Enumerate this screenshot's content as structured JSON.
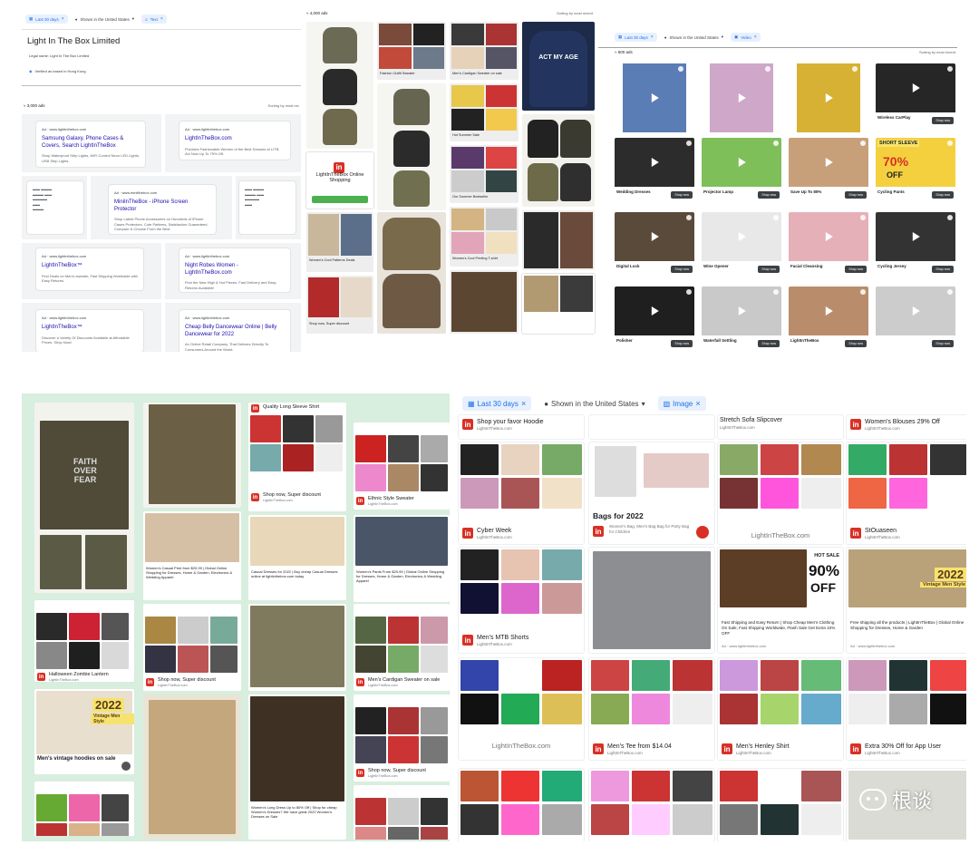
{
  "panel1": {
    "chips": [
      {
        "label": "Last 30 days",
        "icon": "calendar-icon"
      },
      {
        "label": "Shown in the United States",
        "icon": "location-icon"
      },
      {
        "label": "Text",
        "icon": "text-format-icon"
      }
    ],
    "advertiser_name": "Light In The Box Limited",
    "legal_name": "Legal name: Light In The Box Limited",
    "based_in": "Verified as based in Hong Kong",
    "ads_count": "≈ 3,000 ads",
    "sort_label": "Sorting by most rec",
    "cards": [
      {
        "ad": "Ad · www.lightinthebox.com",
        "title": "Samsung Galaxy, Phone Cases & Covers, Search LightInTheBox",
        "desc": "Shop Waterproof Strip Lights, WiFi Control Neon LED Lights, USB Strip Lights."
      },
      {
        "ad": "Ad · www.lightinthebox.com",
        "title": "LightInTheBox.com",
        "desc": "Provides Fashionable Women of the Best Dresses at LITB, Act Now Up To 75% Off."
      },
      {
        "ad": "Ad · www.minitthebox.com",
        "title": "MiniInTheBox - iPhone Screen Protector",
        "desc": "Shop Latest Phone Accessories on Hundreds of iPhone Cases Protectors, Cute Patterns, Satisfaction Guaranteed, Compare & Choose From the Best."
      },
      {
        "ad": "Ad · www.lightinthebox.com",
        "title": "LightInTheBox™",
        "desc": "Find Deals on Men's sweater, Fast Shipping Worldwide with Easy Returns."
      },
      {
        "ad": "Ad · www.lightinthebox.com",
        "title": "Night Robes Women - LightInTheBox.com",
        "desc": "Find the New High & Hot Pieces. Fast Delivery and Easy Returns Available!"
      },
      {
        "ad": "Ad · www.lightinthebox.com",
        "title": "LightInTheBox™",
        "desc": "Discover a Variety Of Discounts Available at Affordable Prices. Shop Now!"
      },
      {
        "ad": "Ad · www.lightinthebox.com",
        "title": "Cheap Belly Dancewear Online | Belly Dancewear for 2022",
        "desc": "An Online Retail Company, That Delivers Directly To Consumers Around the World."
      }
    ]
  },
  "panel2": {
    "ads_count": "≈ 4,000 ads",
    "sort_label": "Sorting by most recent",
    "labels": [
      "Fashion Outfit Sweater",
      "Men's Cardigan Sweater on sale",
      "LightInTheBox Online Shopping",
      "Hot Summer Sale",
      "Our Summer Bestseller",
      "Women's Cool Patterns Deals",
      "Women's Cool Printing T-shirt",
      "Shop now, Super discount"
    ],
    "shirt_print": "ACT MY AGE"
  },
  "panel3": {
    "chips": [
      {
        "label": "Last 30 days",
        "icon": "calendar-icon"
      },
      {
        "label": "Shown in the United States",
        "icon": "location-icon"
      },
      {
        "label": "Video",
        "icon": "video-icon"
      }
    ],
    "ads_count": "≈ 600 ads",
    "sort_label": "Sorting by most recent",
    "shop_now": "Shop now",
    "sale_text": "SHORT SLEEVE",
    "sale_pct": "70%",
    "sale_off": "OFF",
    "labels": [
      "Wireless CarPlay",
      "Wedding Dresses",
      "Projector Lamp",
      "Save Up To 80%",
      "Cycling Pants",
      "Digital Lock",
      "Wine Opener",
      "Facial Cleansing",
      "Cycling Jersey",
      "Polisher",
      "Waterfall Settling",
      "LightInTheBox"
    ]
  },
  "panel4": {
    "labels": [
      "Quality Long Sleeve Shirt",
      "Shop now, Super discount",
      "Ethnic Style Sweater",
      "Halloween Zombie Lantern",
      "Shop now, Super discount",
      "Men's Cardigan Sweater on sale",
      "Shop now, Super discount"
    ],
    "banner_title": "2022",
    "banner_sub": "Vintage Men Style",
    "banner_caption": "Men's vintage hoodies on sale",
    "shirt_print": "FAITH OVER FEAR",
    "texts": [
      "Women's Casual Print from $20.99 | Global Online Shopping for Dresses, Home & Garden, Electronics & Wedding Apparel",
      "Casual Dresses for 2022 | Buy cheap Casual Dresses online at lightinthebox.com today",
      "Women's Pants From $20.99 | Global Online Shopping for Dresses, Home & Garden, Electronics & Wedding Apparel",
      "Women's Long Dress Up to 80% Off | Shop for cheap Women's Dresses? We have great 2022 Women's Dresses on Sale"
    ]
  },
  "panel5": {
    "chips": [
      {
        "label": "Last 30 days",
        "icon": "calendar-icon"
      },
      {
        "label": "Shown in the United States",
        "icon": "location-icon"
      },
      {
        "label": "Image",
        "icon": "image-icon"
      }
    ],
    "tile_labels": [
      "Shop your favor Hoodie",
      "Stretch Sofa Slipcover",
      "Women's Blouses 29% Off",
      "Cyber Week",
      "Bags for 2022",
      "LightInTheBox.com",
      "StOuaseen",
      "Men's MTB Shorts",
      "LightInTheBox.com",
      "Men's Tee from $14.04",
      "Men's Henley Shirt",
      "Extra 30% Off for App User"
    ],
    "domain": "LightInTheBox.com",
    "bags_sub": "Women's Bag, Men's Bag Bag for Party Bag for Children",
    "hot_sale": "HOT SALE",
    "hot_pct": "90%",
    "hot_off": "OFF",
    "vintage_year": "2022",
    "vintage_sub": "Vintage Men Style",
    "text_fast": "Fast Shipping and Easy Return | Shop Cheap Men's Clothing On Sale, Fast Shipping Worldwide, Flash Sale Get Extra 10% OFF",
    "text_free": "Free shipping all the products | LightInTheBox | Global Online Shopping for Dresses, Home & Garden",
    "ad_url": "Ad · www.lightinthebox.com",
    "wm_text": "根谈",
    "brand_letter": "in"
  },
  "colors": {
    "accent": "#1a73e8",
    "brand": "#d93025",
    "chip_bg": "#e8f0fe"
  }
}
